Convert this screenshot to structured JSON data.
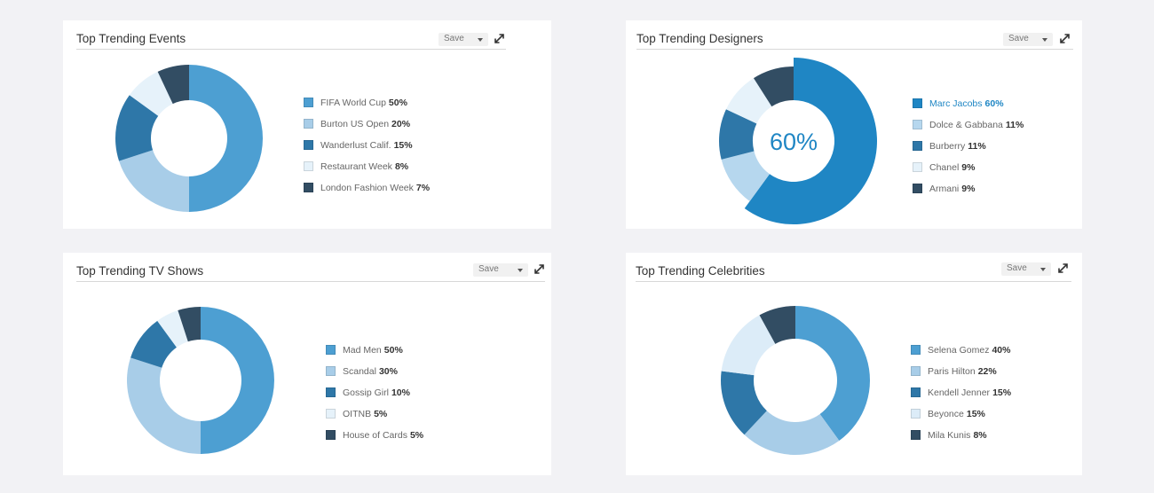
{
  "save_label": "Save",
  "panels": [
    {
      "title": "Top Trending Events",
      "chart_data": {
        "type": "pie",
        "title": "Top Trending Events",
        "categories": [
          "FIFA World Cup",
          "Burton US Open",
          "Wanderlust Calif.",
          "Restaurant Week",
          "London Fashion Week"
        ],
        "values": [
          50,
          20,
          15,
          8,
          7
        ],
        "value_labels": [
          "50%",
          "20%",
          "15%",
          "8%",
          "7%"
        ],
        "colors": [
          "#4d9fd2",
          "#a8cde8",
          "#2e77a8",
          "#e6f2fa",
          "#324d63"
        ],
        "legend_position": "right"
      }
    },
    {
      "title": "Top Trending Designers",
      "center_label": "60%",
      "highlight_index": 0,
      "chart_data": {
        "type": "pie",
        "title": "Top Trending Designers",
        "categories": [
          "Marc Jacobs",
          "Dolce & Gabbana",
          "Burberry",
          "Chanel",
          "Armani"
        ],
        "values": [
          60,
          11,
          11,
          9,
          9
        ],
        "value_labels": [
          "60%",
          "11%",
          "11%",
          "9%",
          "9%"
        ],
        "colors": [
          "#1f86c4",
          "#b6d7ee",
          "#2e77a8",
          "#e6f2fa",
          "#324d63"
        ],
        "legend_position": "right"
      }
    },
    {
      "title": "Top Trending TV Shows",
      "chart_data": {
        "type": "pie",
        "title": "Top Trending TV Shows",
        "categories": [
          "Mad Men",
          "Scandal",
          "Gossip Girl",
          "OITNB",
          "House of Cards"
        ],
        "values": [
          50,
          30,
          10,
          5,
          5
        ],
        "value_labels": [
          "50%",
          "30%",
          "10%",
          "5%",
          "5%"
        ],
        "colors": [
          "#4d9fd2",
          "#a8cde8",
          "#2e77a8",
          "#e6f2fa",
          "#324d63"
        ],
        "legend_position": "right"
      }
    },
    {
      "title": "Top Trending Celebrities",
      "chart_data": {
        "type": "pie",
        "title": "Top Trending Celebrities",
        "categories": [
          "Selena Gomez",
          "Paris Hilton",
          "Kendell Jenner",
          "Beyonce",
          "Mila Kunis"
        ],
        "values": [
          40,
          22,
          15,
          15,
          8
        ],
        "value_labels": [
          "40%",
          "22%",
          "15%",
          "15%",
          "8%"
        ],
        "colors": [
          "#4d9fd2",
          "#a8cde8",
          "#2e77a8",
          "#dcecf8",
          "#324d63"
        ],
        "legend_position": "right"
      }
    }
  ]
}
